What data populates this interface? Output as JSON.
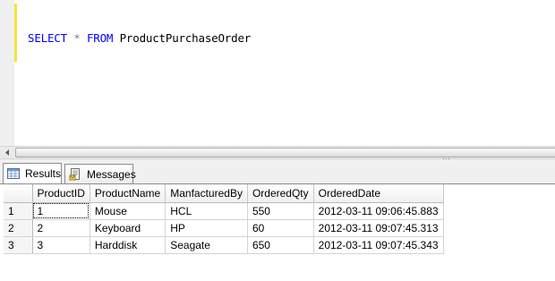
{
  "editor": {
    "query_keyword_select": "SELECT",
    "query_star": "*",
    "query_keyword_from": "FROM",
    "query_table": "ProductPurchaseOrder",
    "colors": {
      "keyword": "#0000ff",
      "operator": "#808080",
      "change_bar": "#f4e53a"
    }
  },
  "scrollbar": {
    "left_arrow_icon": "chevron-left-icon",
    "grip_icon": "scroll-grip-icon"
  },
  "tabs": [
    {
      "label": "Results",
      "icon": "grid-icon",
      "active": true
    },
    {
      "label": "Messages",
      "icon": "messages-icon",
      "active": false
    }
  ],
  "grid": {
    "columns": [
      "ProductID",
      "ProductName",
      "ManfacturedBy",
      "OrderedQty",
      "OrderedDate"
    ],
    "rows": [
      {
        "num": "1",
        "cells": [
          "1",
          "Mouse",
          "HCL",
          "550",
          "2012-03-11 09:06:45.883"
        ]
      },
      {
        "num": "2",
        "cells": [
          "2",
          "Keyboard",
          "HP",
          "60",
          "2012-03-11 09:07:45.313"
        ]
      },
      {
        "num": "3",
        "cells": [
          "3",
          "Harddisk",
          "Seagate",
          "650",
          "2012-03-11 09:07:45.343"
        ]
      }
    ]
  }
}
